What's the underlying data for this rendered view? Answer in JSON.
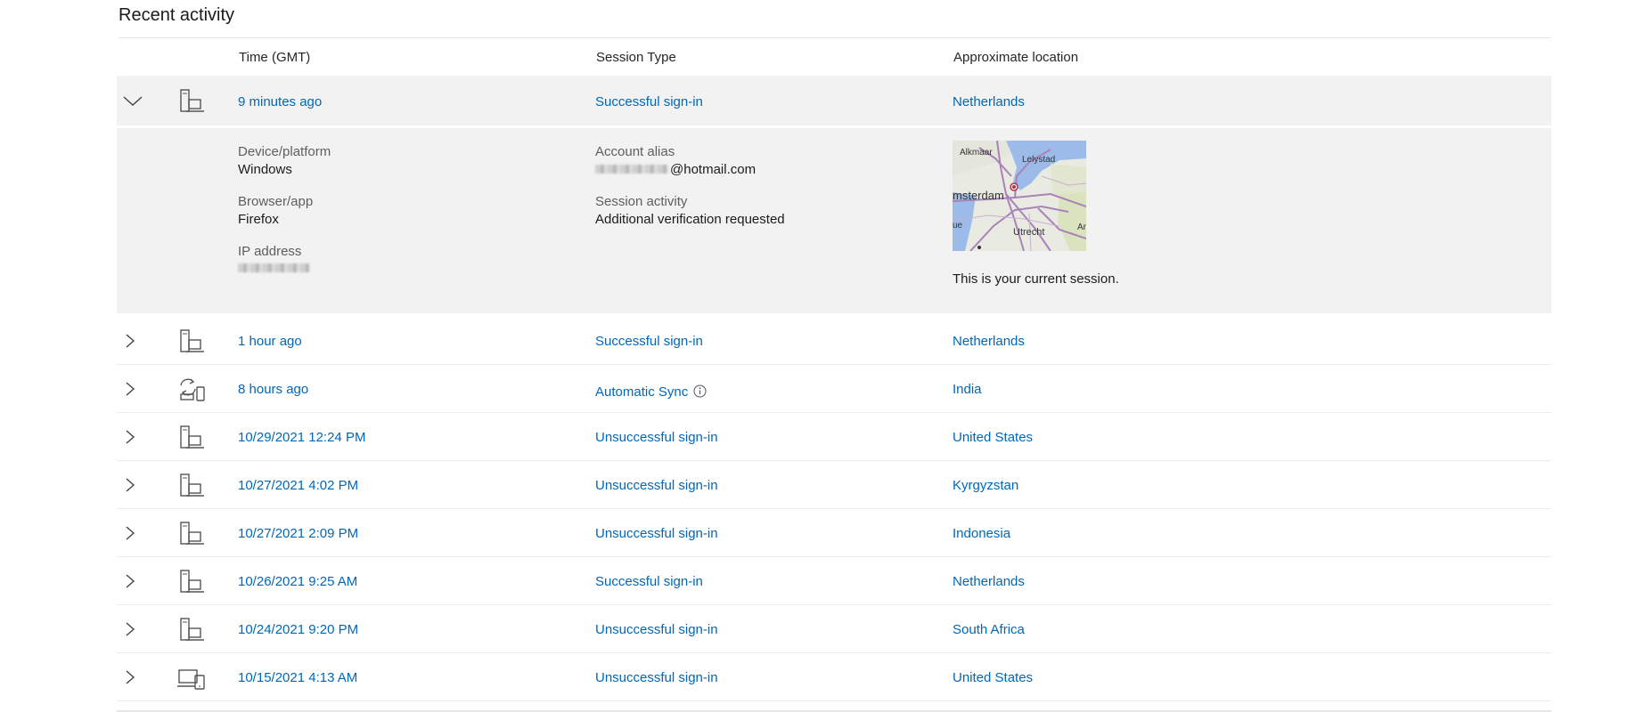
{
  "page": {
    "title": "Recent activity"
  },
  "columns": {
    "time": "Time (GMT)",
    "session_type": "Session Type",
    "location": "Approximate location"
  },
  "expanded": {
    "time": "9 minutes ago",
    "type": "Successful sign-in",
    "location": "Netherlands",
    "device_label": "Device/platform",
    "device_value": "Windows",
    "browser_label": "Browser/app",
    "browser_value": "Firefox",
    "ip_label": "IP address",
    "alias_label": "Account alias",
    "alias_suffix": "@hotmail.com",
    "activity_label": "Session activity",
    "activity_value": "Additional verification requested",
    "map_labels": {
      "alkmaar": "Alkmaar",
      "lelystad": "Lelystad",
      "amsterdam": "msterdam",
      "utrecht": "Utrecht",
      "left": "ue",
      "right": "Ar"
    },
    "current_session": "This is your current session."
  },
  "rows": [
    {
      "time": "1 hour ago",
      "type": "Successful sign-in",
      "location": "Netherlands",
      "icon": "pc-icon"
    },
    {
      "time": "8 hours ago",
      "type": "Automatic Sync",
      "location": "India",
      "icon": "sync-icon",
      "info": true
    },
    {
      "time": "10/29/2021 12:24 PM",
      "type": "Unsuccessful sign-in",
      "location": "United States",
      "icon": "pc-icon"
    },
    {
      "time": "10/27/2021 4:02 PM",
      "type": "Unsuccessful sign-in",
      "location": "Kyrgyzstan",
      "icon": "pc-icon"
    },
    {
      "time": "10/27/2021 2:09 PM",
      "type": "Unsuccessful sign-in",
      "location": "Indonesia",
      "icon": "pc-icon"
    },
    {
      "time": "10/26/2021 9:25 AM",
      "type": "Successful sign-in",
      "location": "Netherlands",
      "icon": "pc-icon"
    },
    {
      "time": "10/24/2021 9:20 PM",
      "type": "Unsuccessful sign-in",
      "location": "South Africa",
      "icon": "pc-icon"
    },
    {
      "time": "10/15/2021 4:13 AM",
      "type": "Unsuccessful sign-in",
      "location": "United States",
      "icon": "laptop-phone-icon"
    }
  ],
  "colors": {
    "link": "#0067b8",
    "expanded_bg": "#f2f2f2"
  }
}
